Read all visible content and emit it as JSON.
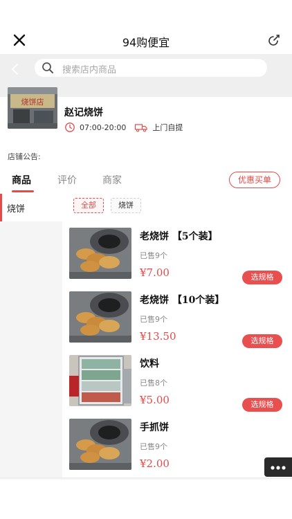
{
  "header": {
    "title": "94购便宜",
    "close_icon": "close-icon",
    "share_icon": "share-icon"
  },
  "search": {
    "placeholder": "搜索店内商品",
    "back_icon": "chevron-left-icon",
    "search_icon": "search-icon"
  },
  "store": {
    "name": "赵记烧饼",
    "hours": "07:00-20:00",
    "delivery": "上门自提",
    "photo_sign": "烧饼店",
    "notice_label": "店铺公告:"
  },
  "tabs": {
    "items": [
      "商品",
      "评价",
      "商家"
    ],
    "active": "商品",
    "promo_button": "优惠买单"
  },
  "sidebar": {
    "items": [
      "烧饼"
    ],
    "active": "烧饼"
  },
  "chips": {
    "items": [
      "全部",
      "烧饼"
    ],
    "active": "全部"
  },
  "products": [
    {
      "name": "老烧饼 【5个装】",
      "sold": "已售9个",
      "price": "¥7.00",
      "button": "选规格",
      "image": "flatbread"
    },
    {
      "name": "老烧饼 【10个装】",
      "sold": "已售9个",
      "price": "¥13.50",
      "button": "选规格",
      "image": "flatbread"
    },
    {
      "name": "饮料",
      "sold": "已售8个",
      "price": "¥5.00",
      "button": "选规格",
      "image": "drinks-fridge"
    },
    {
      "name": "手抓饼",
      "sold": "已售9个",
      "price": "¥2.00",
      "button": "",
      "image": "flatbread"
    }
  ],
  "colors": {
    "accent": "#e14b4b",
    "button": "#e85050",
    "search_bar_bg": "#efefef",
    "sidebar_bg": "#f5f5f5"
  }
}
